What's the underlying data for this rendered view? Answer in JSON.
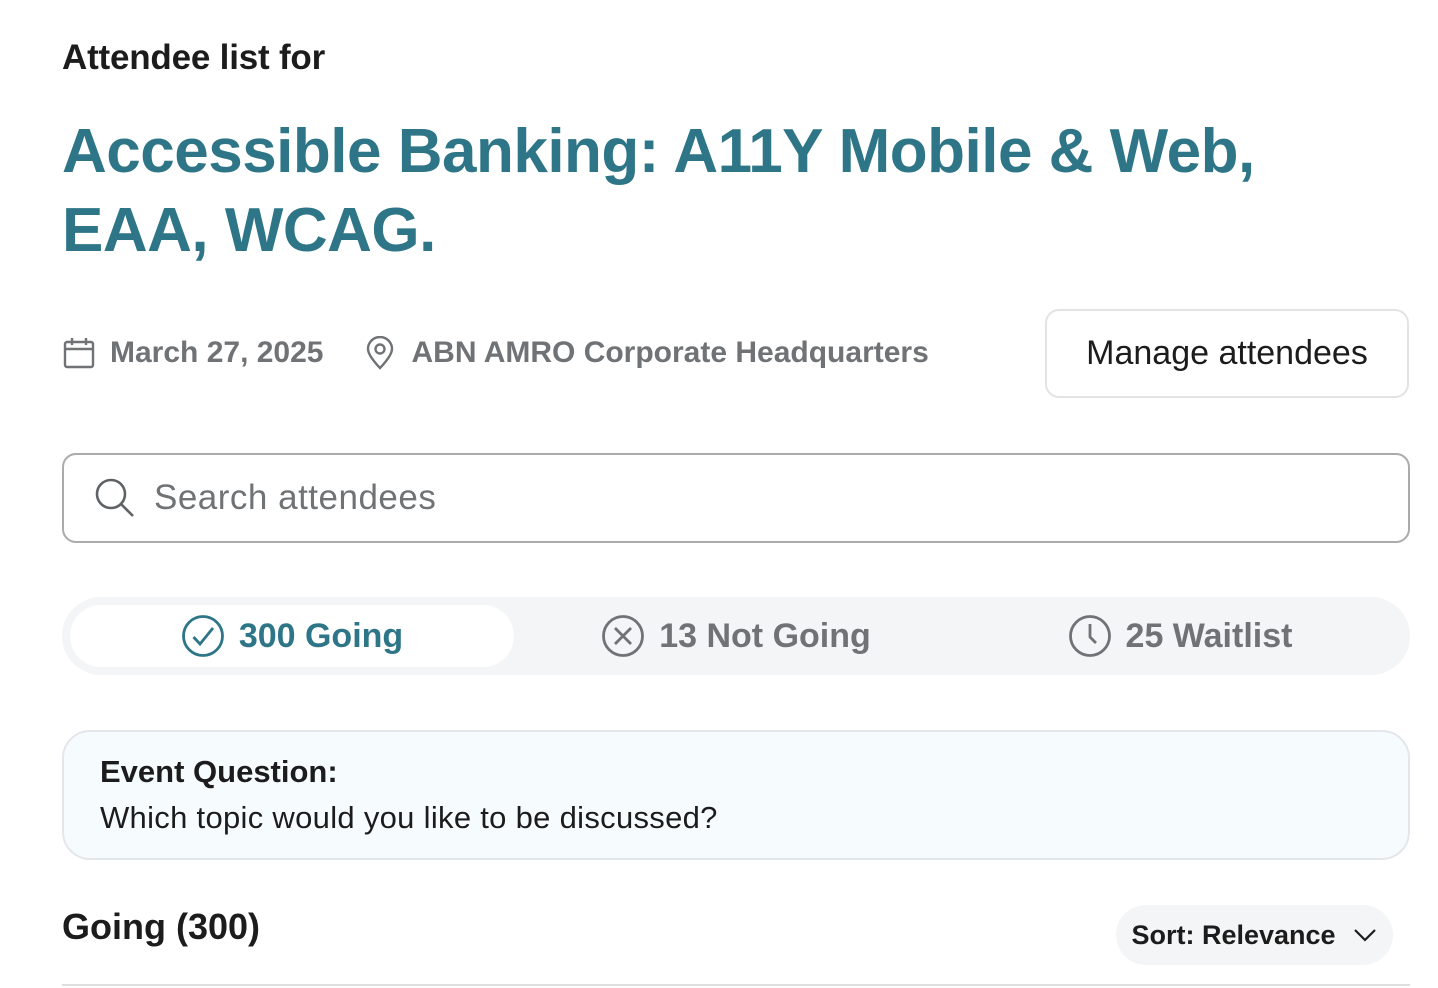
{
  "header": {
    "subtitle": "Attendee list for",
    "event_title": "Accessible Banking: A11Y Mobile & Web, EAA, WCAG."
  },
  "meta": {
    "date": "March 27, 2025",
    "date_icon": "calendar-icon",
    "location": "ABN AMRO Corporate Headquarters",
    "location_icon": "map-pin-icon"
  },
  "actions": {
    "manage_label": "Manage attendees"
  },
  "search": {
    "placeholder": "Search attendees",
    "value": "",
    "icon": "search-icon"
  },
  "tabs": [
    {
      "label": "300 Going",
      "icon": "check-circle-icon",
      "active": true
    },
    {
      "label": "13 Not Going",
      "icon": "x-circle-icon",
      "active": false
    },
    {
      "label": "25 Waitlist",
      "icon": "clock-icon",
      "active": false
    }
  ],
  "question": {
    "label": "Event Question:",
    "text": "Which topic would you like to be discussed?"
  },
  "list": {
    "heading": "Going (300)",
    "sort_label": "Sort: Relevance",
    "sort_icon": "chevron-down-icon"
  },
  "colors": {
    "accent": "#2e7687",
    "muted": "#6f7376",
    "tab_bg": "#f4f5f6",
    "card_bg": "#f6fbfd"
  }
}
